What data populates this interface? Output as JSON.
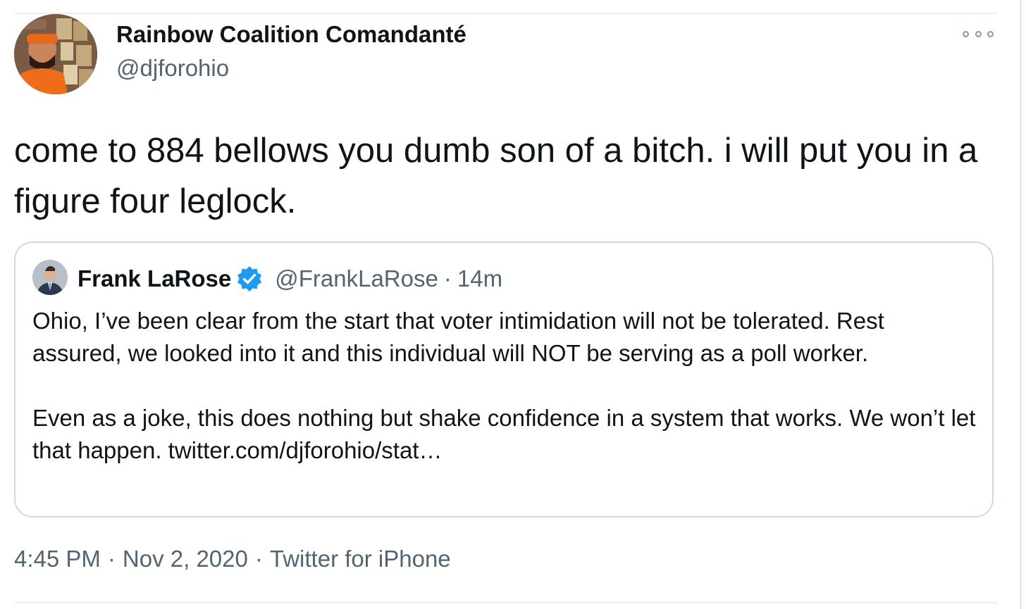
{
  "tweet": {
    "author_name": "Rainbow Coalition Comandanté",
    "author_handle": "@djforohio",
    "more_icon": "more-options-icon",
    "text": "come to 884 bellows you dumb son of a bitch. i will put you in a figure four leglock.",
    "timestamp": "4:45 PM",
    "date": "Nov 2, 2020",
    "separator": "·",
    "source": "Twitter for iPhone"
  },
  "quoted_tweet": {
    "author_name": "Frank LaRose",
    "verified": true,
    "verified_icon": "verified-badge-icon",
    "author_handle": "@FrankLaRose",
    "separator": "·",
    "age": "14m",
    "paragraph_1": "Ohio, I’ve been clear from the start that voter intimidation will not be tolerated. Rest assured, we looked into it and this individual will NOT be serving as a poll worker.",
    "paragraph_2": "Even as a joke, this does nothing but shake confidence in a system that works. We won’t let that happen. twitter.com/djforohio/stat…"
  },
  "colors": {
    "text_primary": "#0f1419",
    "text_secondary": "#536471",
    "border": "#cfd9de",
    "verified_blue": "#1d9bf0"
  }
}
